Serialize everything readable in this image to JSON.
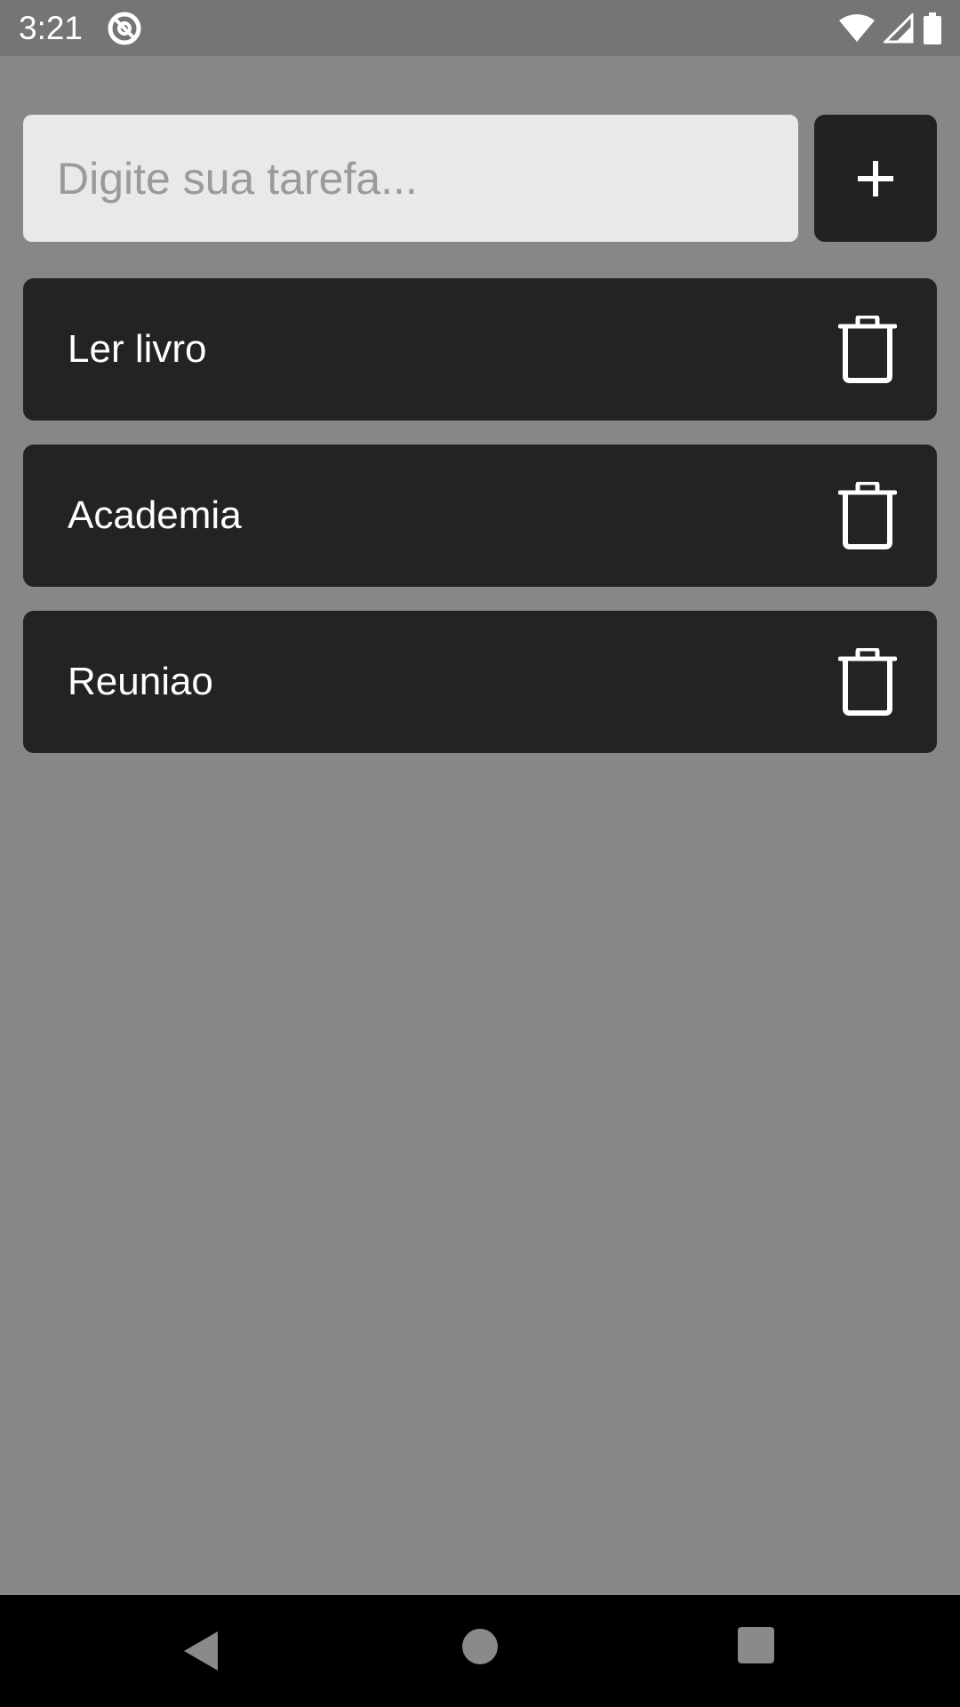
{
  "status_bar": {
    "time": "3:21",
    "icons": [
      "do-not-disturb-icon",
      "wifi-icon",
      "signal-icon",
      "battery-icon"
    ]
  },
  "input": {
    "placeholder": "Digite sua tarefa...",
    "value": ""
  },
  "add_button": {
    "icon": "plus-icon"
  },
  "tasks": [
    {
      "label": "Ler livro",
      "action_icon": "trash-icon"
    },
    {
      "label": "Academia",
      "action_icon": "trash-icon"
    },
    {
      "label": "Reuniao",
      "action_icon": "trash-icon"
    }
  ],
  "nav_bar": {
    "buttons": [
      "back-icon",
      "home-icon",
      "recents-icon"
    ]
  },
  "colors": {
    "background": "#878787",
    "status_bar": "#757575",
    "card": "#232323",
    "input_background": "#e8eaea",
    "placeholder": "#9a9a9a",
    "text": "#ffffff",
    "nav_bar": "#000000"
  }
}
